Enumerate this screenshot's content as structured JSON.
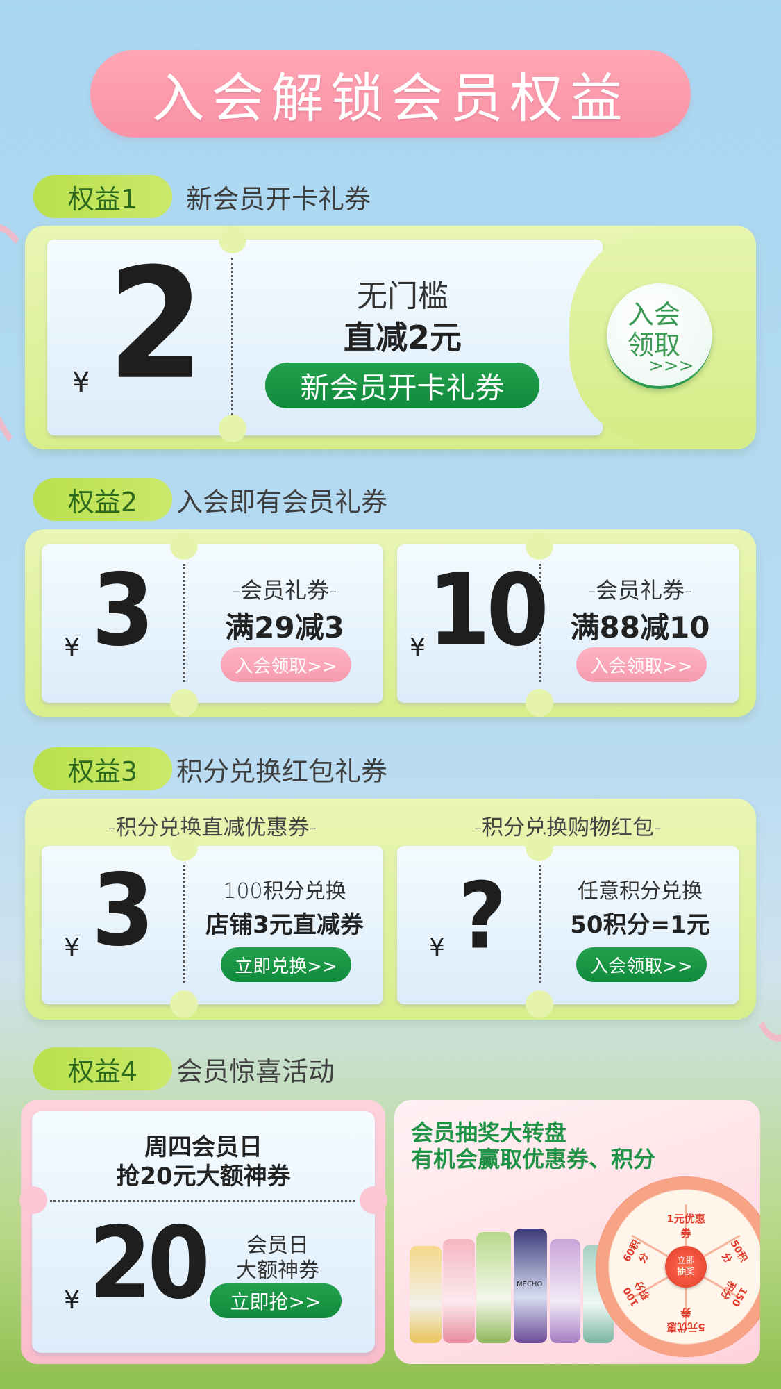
{
  "header": {
    "title": "入会解锁会员权益"
  },
  "benefit1": {
    "tag": "权益1",
    "title": "新会员开卡礼券",
    "yen": "¥",
    "amount": "2",
    "line1": "无门槛",
    "line2": "直减2元",
    "button": "新会员开卡礼券",
    "side_line1": "入会",
    "side_line2": "领取",
    "side_arrows": ">>>"
  },
  "benefit2": {
    "tag": "权益2",
    "title": "入会即有会员礼券",
    "coupons": [
      {
        "yen": "¥",
        "amount": "3",
        "subtitle": "-会员礼券-",
        "desc": "满29减3",
        "button": "入会领取>>"
      },
      {
        "yen": "¥",
        "amount": "10",
        "subtitle": "-会员礼券-",
        "desc": "满88减10",
        "button": "入会领取>>"
      }
    ]
  },
  "benefit3": {
    "tag": "权益3",
    "title": "积分兑换红包礼券",
    "left_caption": "-积分兑换直减优惠券-",
    "right_caption": "-积分兑换购物红包-",
    "coupons": [
      {
        "yen": "¥",
        "amount": "3",
        "subtitle": "100积分兑换",
        "desc": "店铺3元直减券",
        "button": "立即兑换>>"
      },
      {
        "yen": "¥",
        "amount": "?",
        "subtitle": "任意积分兑换",
        "desc": "50积分=1元",
        "button": "入会领取>>"
      }
    ]
  },
  "benefit4": {
    "tag": "权益4",
    "title": "会员惊喜活动",
    "card": {
      "line1": "周四会员日",
      "line2": "抢20元大额神券",
      "yen": "¥",
      "amount": "20",
      "sub1": "会员日",
      "sub2": "大额神券",
      "button": "立即抢>>"
    },
    "lottery": {
      "line1": "会员抽奖大转盘",
      "line2": "有机会赢取优惠券、积分",
      "center": "立即抽奖",
      "slices": [
        "1元优惠券",
        "50积分",
        "150积分",
        "5元优惠券",
        "100积分",
        "60积分"
      ],
      "bottle_brand": "MECHO"
    }
  },
  "colors": {
    "pink": "#f992a6",
    "green": "#108b3c",
    "lime": "#c4e55e",
    "sky": "#a9d6f1"
  }
}
